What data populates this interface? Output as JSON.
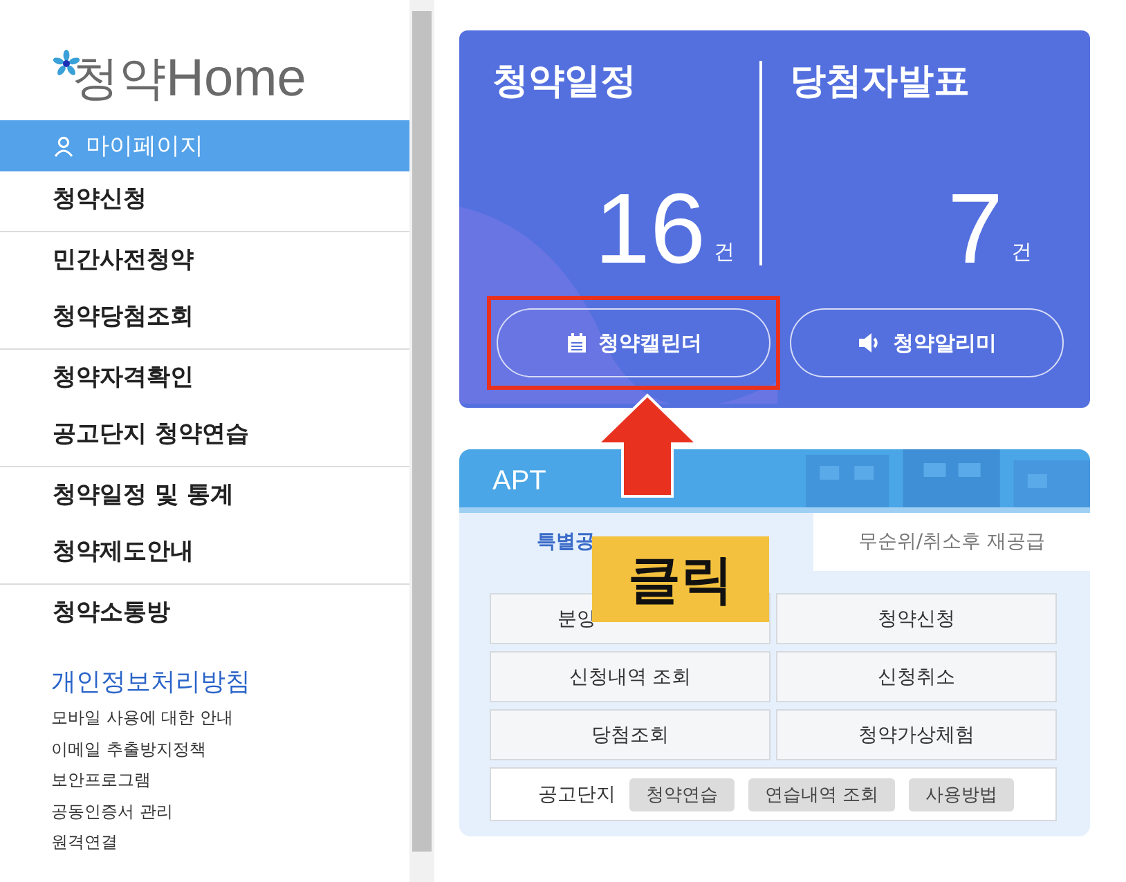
{
  "logo": {
    "text": "청약",
    "brand": "Home"
  },
  "sidebar": {
    "groups": [
      [
        {
          "kind": "account",
          "label": "마이페이지",
          "selected": true
        },
        {
          "kind": "menu",
          "label": "청약신청",
          "selected": false
        }
      ],
      [
        {
          "kind": "menu",
          "label": "민간사전청약",
          "selected": false
        },
        {
          "kind": "menu",
          "label": "청약당첨조회",
          "selected": false
        }
      ],
      [
        {
          "kind": "menu",
          "label": "청약자격확인",
          "selected": false
        },
        {
          "kind": "menu",
          "label": "공고단지 청약연습",
          "selected": false
        }
      ],
      [
        {
          "kind": "menu",
          "label": "청약일정 및 통계",
          "selected": false
        },
        {
          "kind": "menu",
          "label": "청약제도안내",
          "selected": false
        }
      ],
      [
        {
          "kind": "menu",
          "label": "청약소통방",
          "selected": false
        }
      ]
    ],
    "policy_link": "개인정보처리방침",
    "links": [
      "모바일 사용에 대한 안내",
      "이메일 추출방지정책",
      "보안프로그램",
      "공동인증서 관리",
      "원격연결"
    ]
  },
  "summary": {
    "stats": [
      {
        "title": "청약일정",
        "count": "16",
        "unit": "건"
      },
      {
        "title": "당첨자발표",
        "count": "7",
        "unit": "건"
      }
    ],
    "buttons": [
      {
        "kind": "calendar",
        "label": "청약캘린더",
        "highlighted": true
      },
      {
        "kind": "speaker",
        "label": "청약알리미",
        "highlighted": false
      }
    ]
  },
  "apt": {
    "title": "APT",
    "tabs": [
      {
        "label": "특별공",
        "selected": true
      },
      {
        "label": "무순위/취소후 재공급",
        "selected": false
      }
    ],
    "buttons": [
      "분양",
      "청약신청",
      "신청내역 조회",
      "신청취소",
      "당첨조회",
      "청약가상체험"
    ],
    "practice": {
      "label": "공고단지",
      "buttons": [
        "청약연습",
        "연습내역 조회",
        "사용방법"
      ]
    }
  },
  "annotation": {
    "label": "클릭"
  }
}
